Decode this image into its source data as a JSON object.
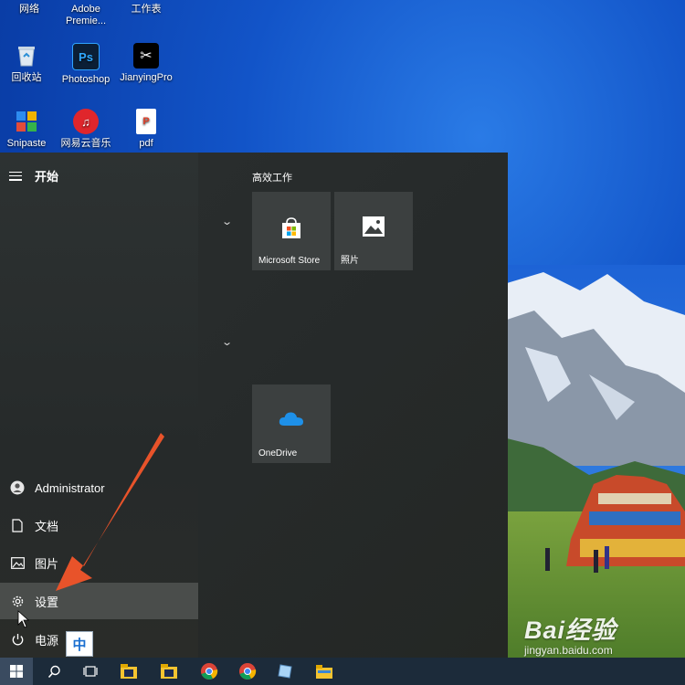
{
  "desktop": {
    "top_labels": [
      "网络",
      "Adobe Premie...",
      "工作表"
    ],
    "icons": [
      {
        "label": "回收站",
        "icon": "recycle-bin-icon"
      },
      {
        "label": "Photoshop",
        "icon": "photoshop-icon"
      },
      {
        "label": "JianyingPro",
        "icon": "jianying-icon"
      },
      {
        "label": "Snipaste",
        "icon": "snipaste-icon"
      },
      {
        "label": "网易云音乐",
        "icon": "netease-music-icon"
      },
      {
        "label": "pdf",
        "icon": "pdf-icon"
      }
    ]
  },
  "start_menu": {
    "title": "开始",
    "user": "Administrator",
    "items": [
      {
        "label": "文档",
        "icon": "document-icon"
      },
      {
        "label": "图片",
        "icon": "pictures-icon"
      },
      {
        "label": "设置",
        "icon": "gear-icon"
      },
      {
        "label": "电源",
        "icon": "power-icon"
      }
    ],
    "group_label": "高效工作",
    "tiles": [
      {
        "label": "Microsoft Store",
        "icon": "store-icon"
      },
      {
        "label": "照片",
        "icon": "photos-icon"
      },
      {
        "label": "OneDrive",
        "icon": "onedrive-icon"
      }
    ]
  },
  "ime": {
    "label": "中"
  },
  "watermark": {
    "logo": "Bai经验",
    "url": "jingyan.baidu.com"
  },
  "taskbar": {
    "buttons": [
      "windows-start-icon",
      "search-icon",
      "task-view-icon",
      "file-explorer-icon",
      "file-explorer-icon",
      "chrome-icon",
      "chrome-icon",
      "notepad-icon",
      "folder-icon"
    ]
  },
  "colors": {
    "accent": "#e8532a",
    "active_item": "#4a4d4b"
  }
}
